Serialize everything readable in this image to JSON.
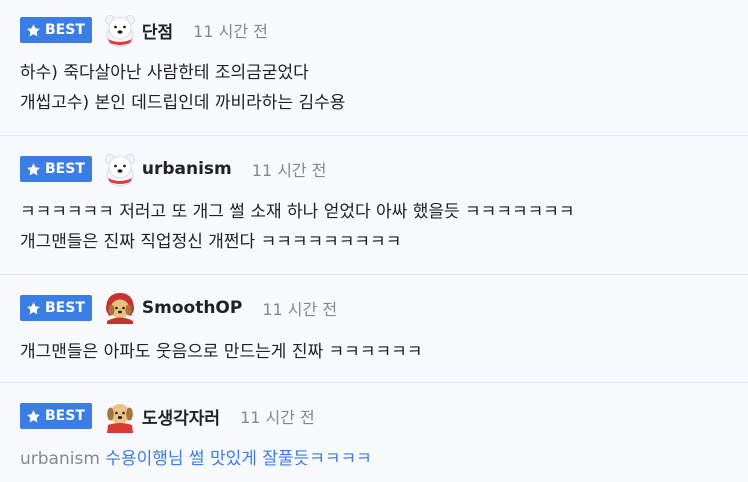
{
  "badge_label": "BEST",
  "comments": [
    {
      "nickname": "단점",
      "time": "11 시간 전",
      "lines": [
        "하수) 죽다살아난 사람한테 조의금굳었다",
        "개씹고수) 본인 데드립인데 까비라하는 김수용"
      ]
    },
    {
      "nickname": "urbanism",
      "time": "11 시간 전",
      "lines": [
        "ㅋㅋㅋㅋㅋㅋ 저러고 또 개그 썰 소재 하나 얻었다 아싸 했을듯 ㅋㅋㅋㅋㅋㅋㅋ",
        "개그맨들은 진짜 직업정신 개쩐다 ㅋㅋㅋㅋㅋㅋㅋㅋㅋ"
      ]
    },
    {
      "nickname": "SmoothOP",
      "time": "11 시간 전",
      "lines": [
        "개그맨들은 아파도 웃음으로 만드는게 진짜 ㅋㅋㅋㅋㅋㅋ"
      ]
    },
    {
      "nickname": "도생각자러",
      "time": "11 시간 전",
      "reply_to": "urbanism",
      "reply_text": "수용이행님 썰 맛있게 잘풀듯ㅋㅋㅋㅋ"
    }
  ],
  "icons": {
    "badge": "star-icon",
    "avatar_bear": "polar-bear-icon",
    "avatar_dog_red": "puppy-red-hood-icon",
    "avatar_dog": "puppy-red-scarf-icon"
  },
  "colors": {
    "badge_bg": "#3b7ee3",
    "reply_text": "#3b7ee3",
    "muted": "#888888",
    "page_bg": "#f7f9fd"
  }
}
